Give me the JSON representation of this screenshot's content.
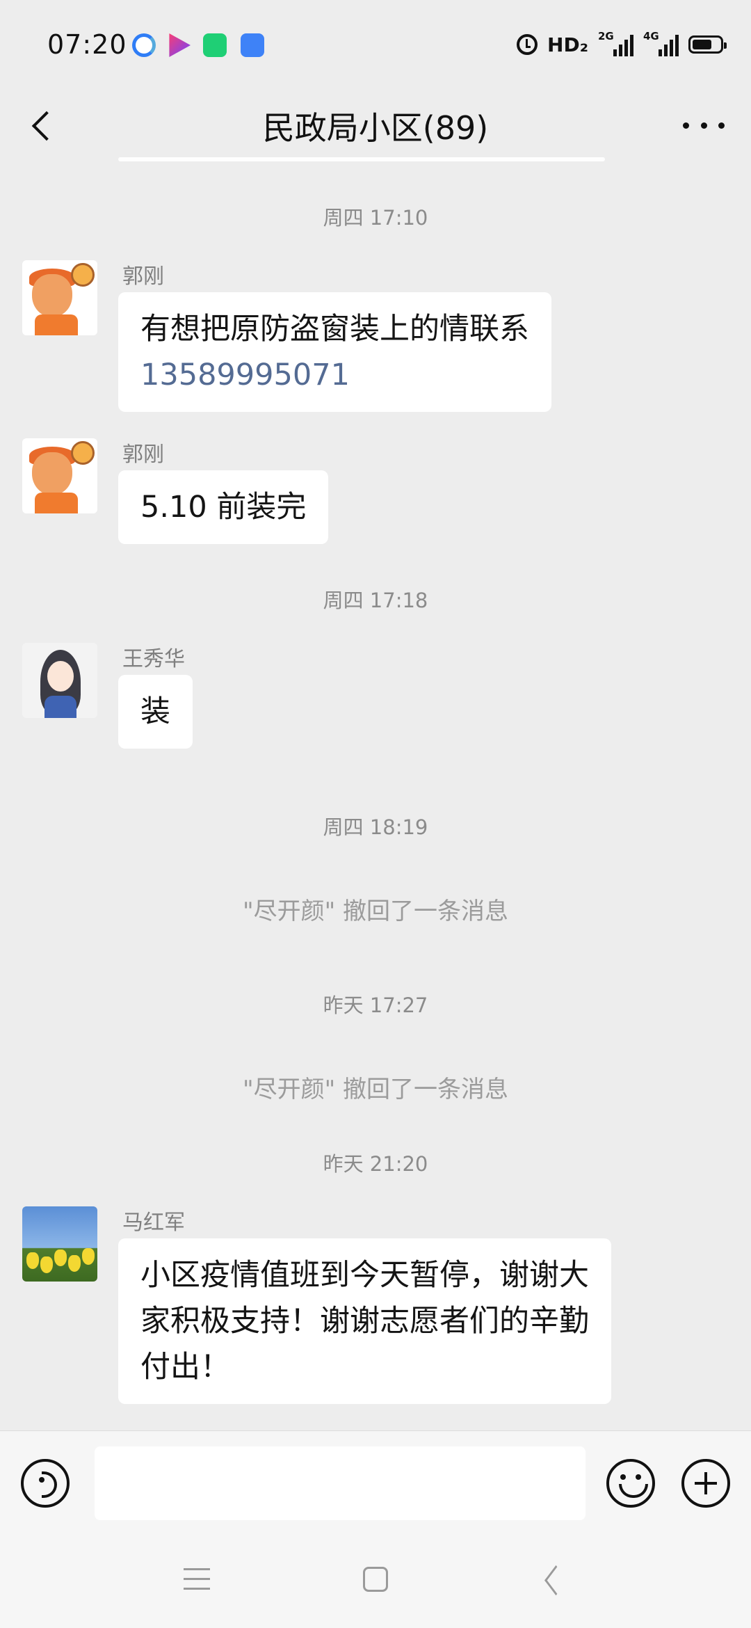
{
  "status_bar": {
    "time": "07:20",
    "hd_label": "HD₂",
    "net_2g": "2G",
    "net_4g": "4G",
    "icons": [
      "browser-app-icon",
      "video-app-icon",
      "market-app-icon",
      "cloud-app-icon",
      "alarm-icon",
      "signal-icon",
      "battery-icon"
    ]
  },
  "nav": {
    "title": "民政局小区(89)"
  },
  "messages": {
    "sep1": "周四 17:10",
    "msg1": {
      "sender": "郭刚",
      "text": "有想把原防盗窗装上的情联系",
      "phone": "13589995071"
    },
    "msg2": {
      "sender": "郭刚",
      "text": "5.10 前装完"
    },
    "sep2": "周四 17:18",
    "msg3": {
      "sender": "王秀华",
      "text": "装"
    },
    "sep3": "周四 18:19",
    "sys1": "\"尽开颜\" 撤回了一条消息",
    "sep4": "昨天 17:27",
    "sys2": "\"尽开颜\" 撤回了一条消息",
    "sep5": "昨天 21:20",
    "msg4": {
      "sender": "马红军",
      "lines": [
        "小区疫情值班到今天暂停，谢谢大",
        "家积极支持！谢谢志愿者们的辛勤",
        "付出！"
      ]
    }
  },
  "input_bar": {
    "value": "",
    "placeholder": ""
  },
  "colors": {
    "background": "#ededed",
    "bubble": "#ffffff",
    "link": "#546b93",
    "meta_text": "#8b8b8b"
  }
}
